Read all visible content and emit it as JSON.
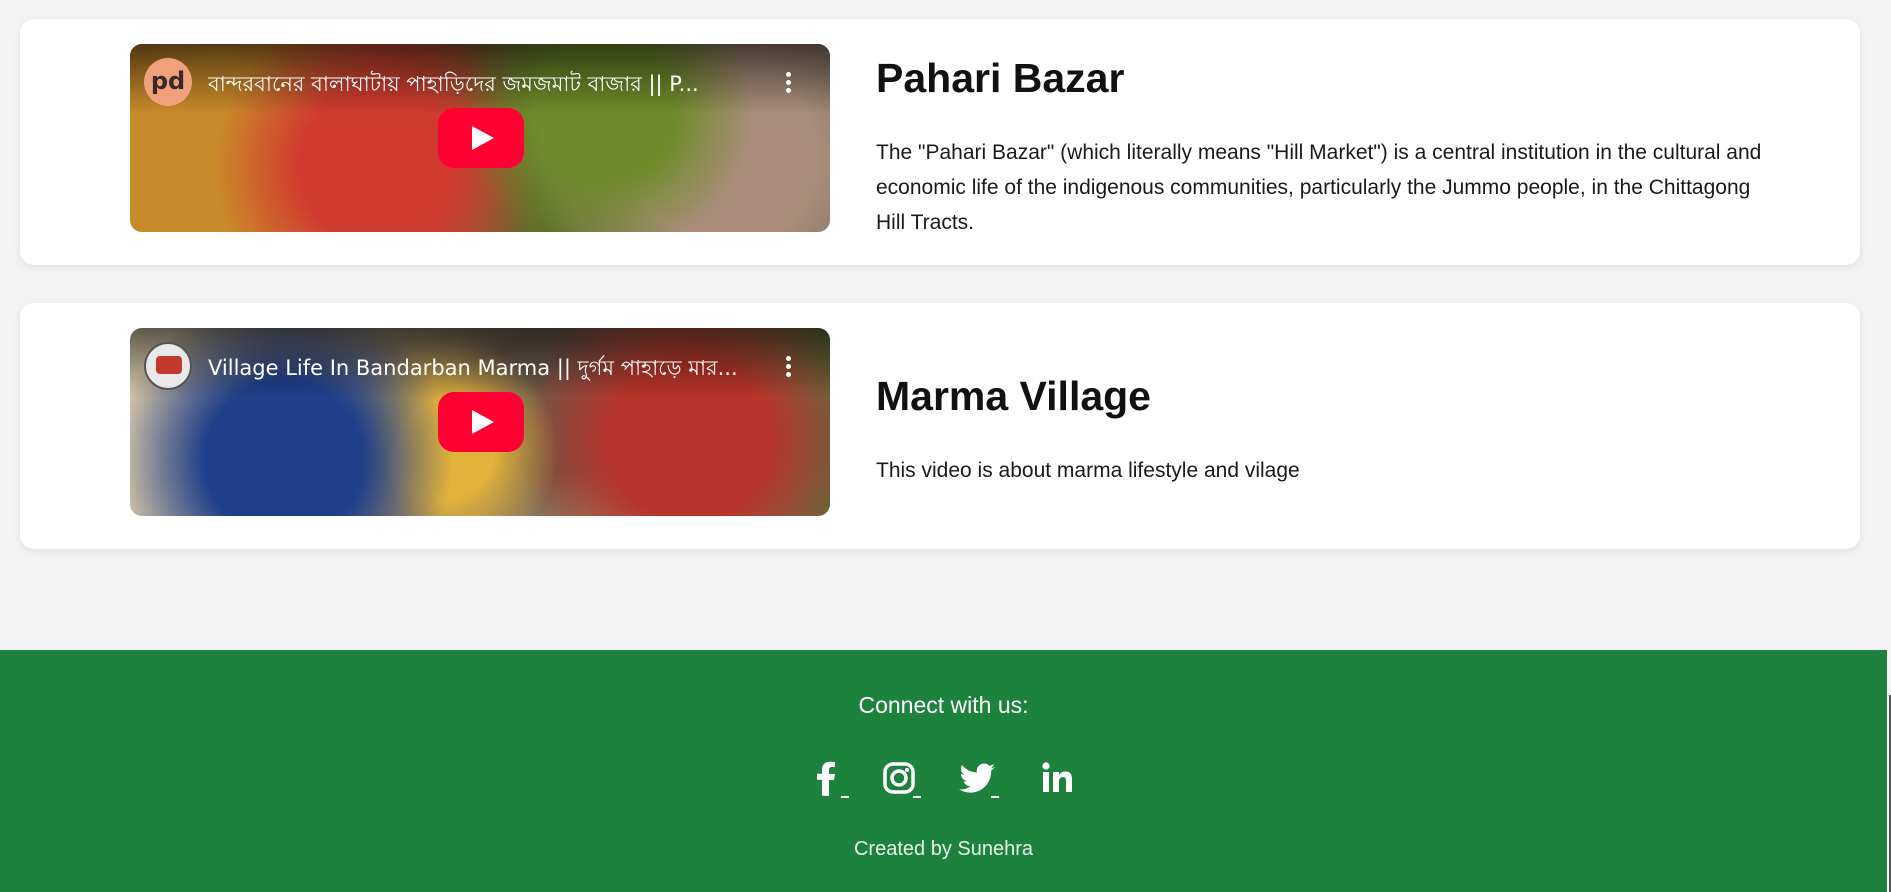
{
  "cards": [
    {
      "title": "Pahari Bazar",
      "description": "The \"Pahari Bazar\" (which literally means \"Hill Market\") is a central institution in the cultural and economic life of the indigenous communities, particularly the Jummo people, in the Chittagong Hill Tracts.",
      "video": {
        "title": "বান্দরবানের বালাঘাটায় পাহাড়িদের জমজমাট বাজার || P...",
        "channel_logo_text": "pd",
        "icons": [
          "channel-avatar-icon",
          "more-vert-icon",
          "youtube-play-icon"
        ]
      }
    },
    {
      "title": "Marma Village",
      "description": "This video is about marma lifestyle and vilage",
      "video": {
        "title": "Village Life In Bandarban Marma || দুর্গম পাহাড়ে মার...",
        "icons": [
          "channel-avatar-icon",
          "more-vert-icon",
          "youtube-play-icon"
        ]
      }
    }
  ],
  "footer": {
    "connect_label": "Connect with us:",
    "socials": [
      "facebook-icon",
      "instagram-icon",
      "twitter-icon",
      "linkedin-icon"
    ],
    "credit": "Created by Sunehra"
  },
  "colors": {
    "page_bg": "#f3f3f3",
    "card_bg": "#ffffff",
    "footer_bg": "#1e823f",
    "youtube_red": "#ff0033"
  }
}
